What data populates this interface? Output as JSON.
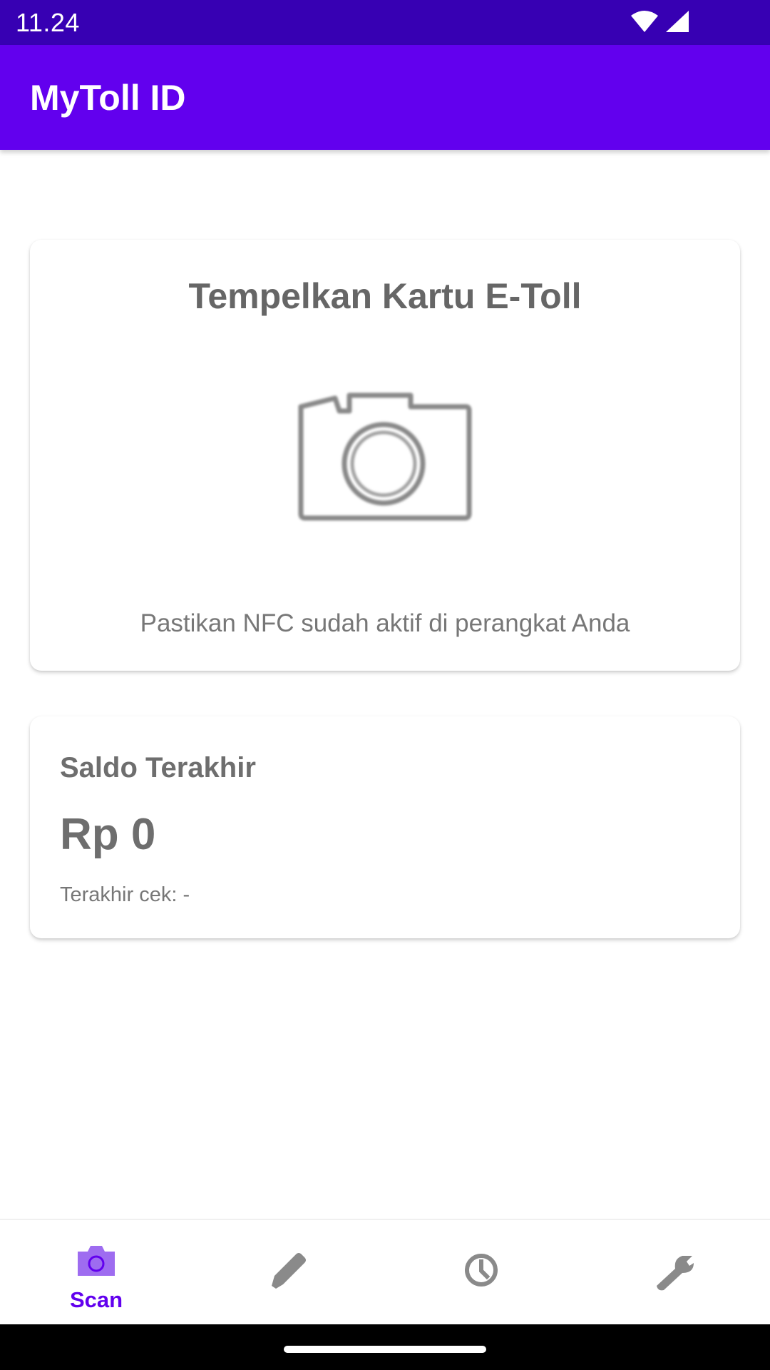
{
  "status_bar": {
    "time": "11.24",
    "icons": [
      "wifi-icon",
      "cellular-signal-icon"
    ]
  },
  "app_bar": {
    "title": "MyToll ID"
  },
  "scan_card": {
    "title": "Tempelkan Kartu E-Toll",
    "icon": "camera-icon",
    "hint": "Pastikan NFC sudah aktif di perangkat Anda"
  },
  "balance_card": {
    "label": "Saldo Terakhir",
    "value": "Rp 0",
    "last_checked": "Terakhir cek: -"
  },
  "bottom_nav": {
    "items": [
      {
        "label": "Scan",
        "icon": "camera-icon",
        "active": true
      },
      {
        "label": "",
        "icon": "pencil-icon",
        "active": false
      },
      {
        "label": "",
        "icon": "clock-icon",
        "active": false
      },
      {
        "label": "",
        "icon": "wrench-icon",
        "active": false
      }
    ]
  },
  "colors": {
    "status_bar": "#3700b3",
    "app_bar": "#6200ee",
    "nav_active": "#6200ee",
    "nav_active_icon": "#9e6cf0",
    "nav_inactive": "#8a8a8a",
    "text_gray": "#6e6e6e"
  }
}
